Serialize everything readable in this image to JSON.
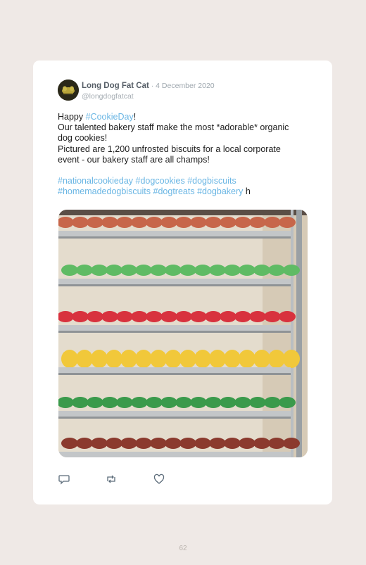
{
  "tweet": {
    "author_name": "Long Dog Fat Cat",
    "separator": " · ",
    "date": "4 December 2020",
    "handle": "@longdogfatcat",
    "line1_prefix": "Happy ",
    "line1_hashtag": "#CookieDay",
    "line1_suffix": "!",
    "line2": "Our talented bakery staff make the most *adorable* organic",
    "line3": "dog cookies!",
    "line4": "Pictured are 1,200 unfrosted biscuits for a local corporate",
    "line5": "event - our bakery staff are all champs!",
    "hashtags_line1": [
      "#nationalcookieday",
      "#dogcookies",
      "#dogbiscuits"
    ],
    "hashtags_line2": [
      "#homemadedogbiscuits",
      "#dogtreats",
      "#dogbakery"
    ],
    "trailing_text": " h"
  },
  "icons": {
    "reply": "reply-icon",
    "retweet": "retweet-icon",
    "like": "heart-icon",
    "avatar": "avatar-logo"
  },
  "photo": {
    "subject": "baking rack with trays of colored dog biscuits",
    "tray_colors": [
      "#c7664a",
      "#5fbb64",
      "#d8323e",
      "#f1c83a",
      "#3a9a4b",
      "#8b3a2e"
    ]
  },
  "footer": {
    "page_number": "62"
  }
}
